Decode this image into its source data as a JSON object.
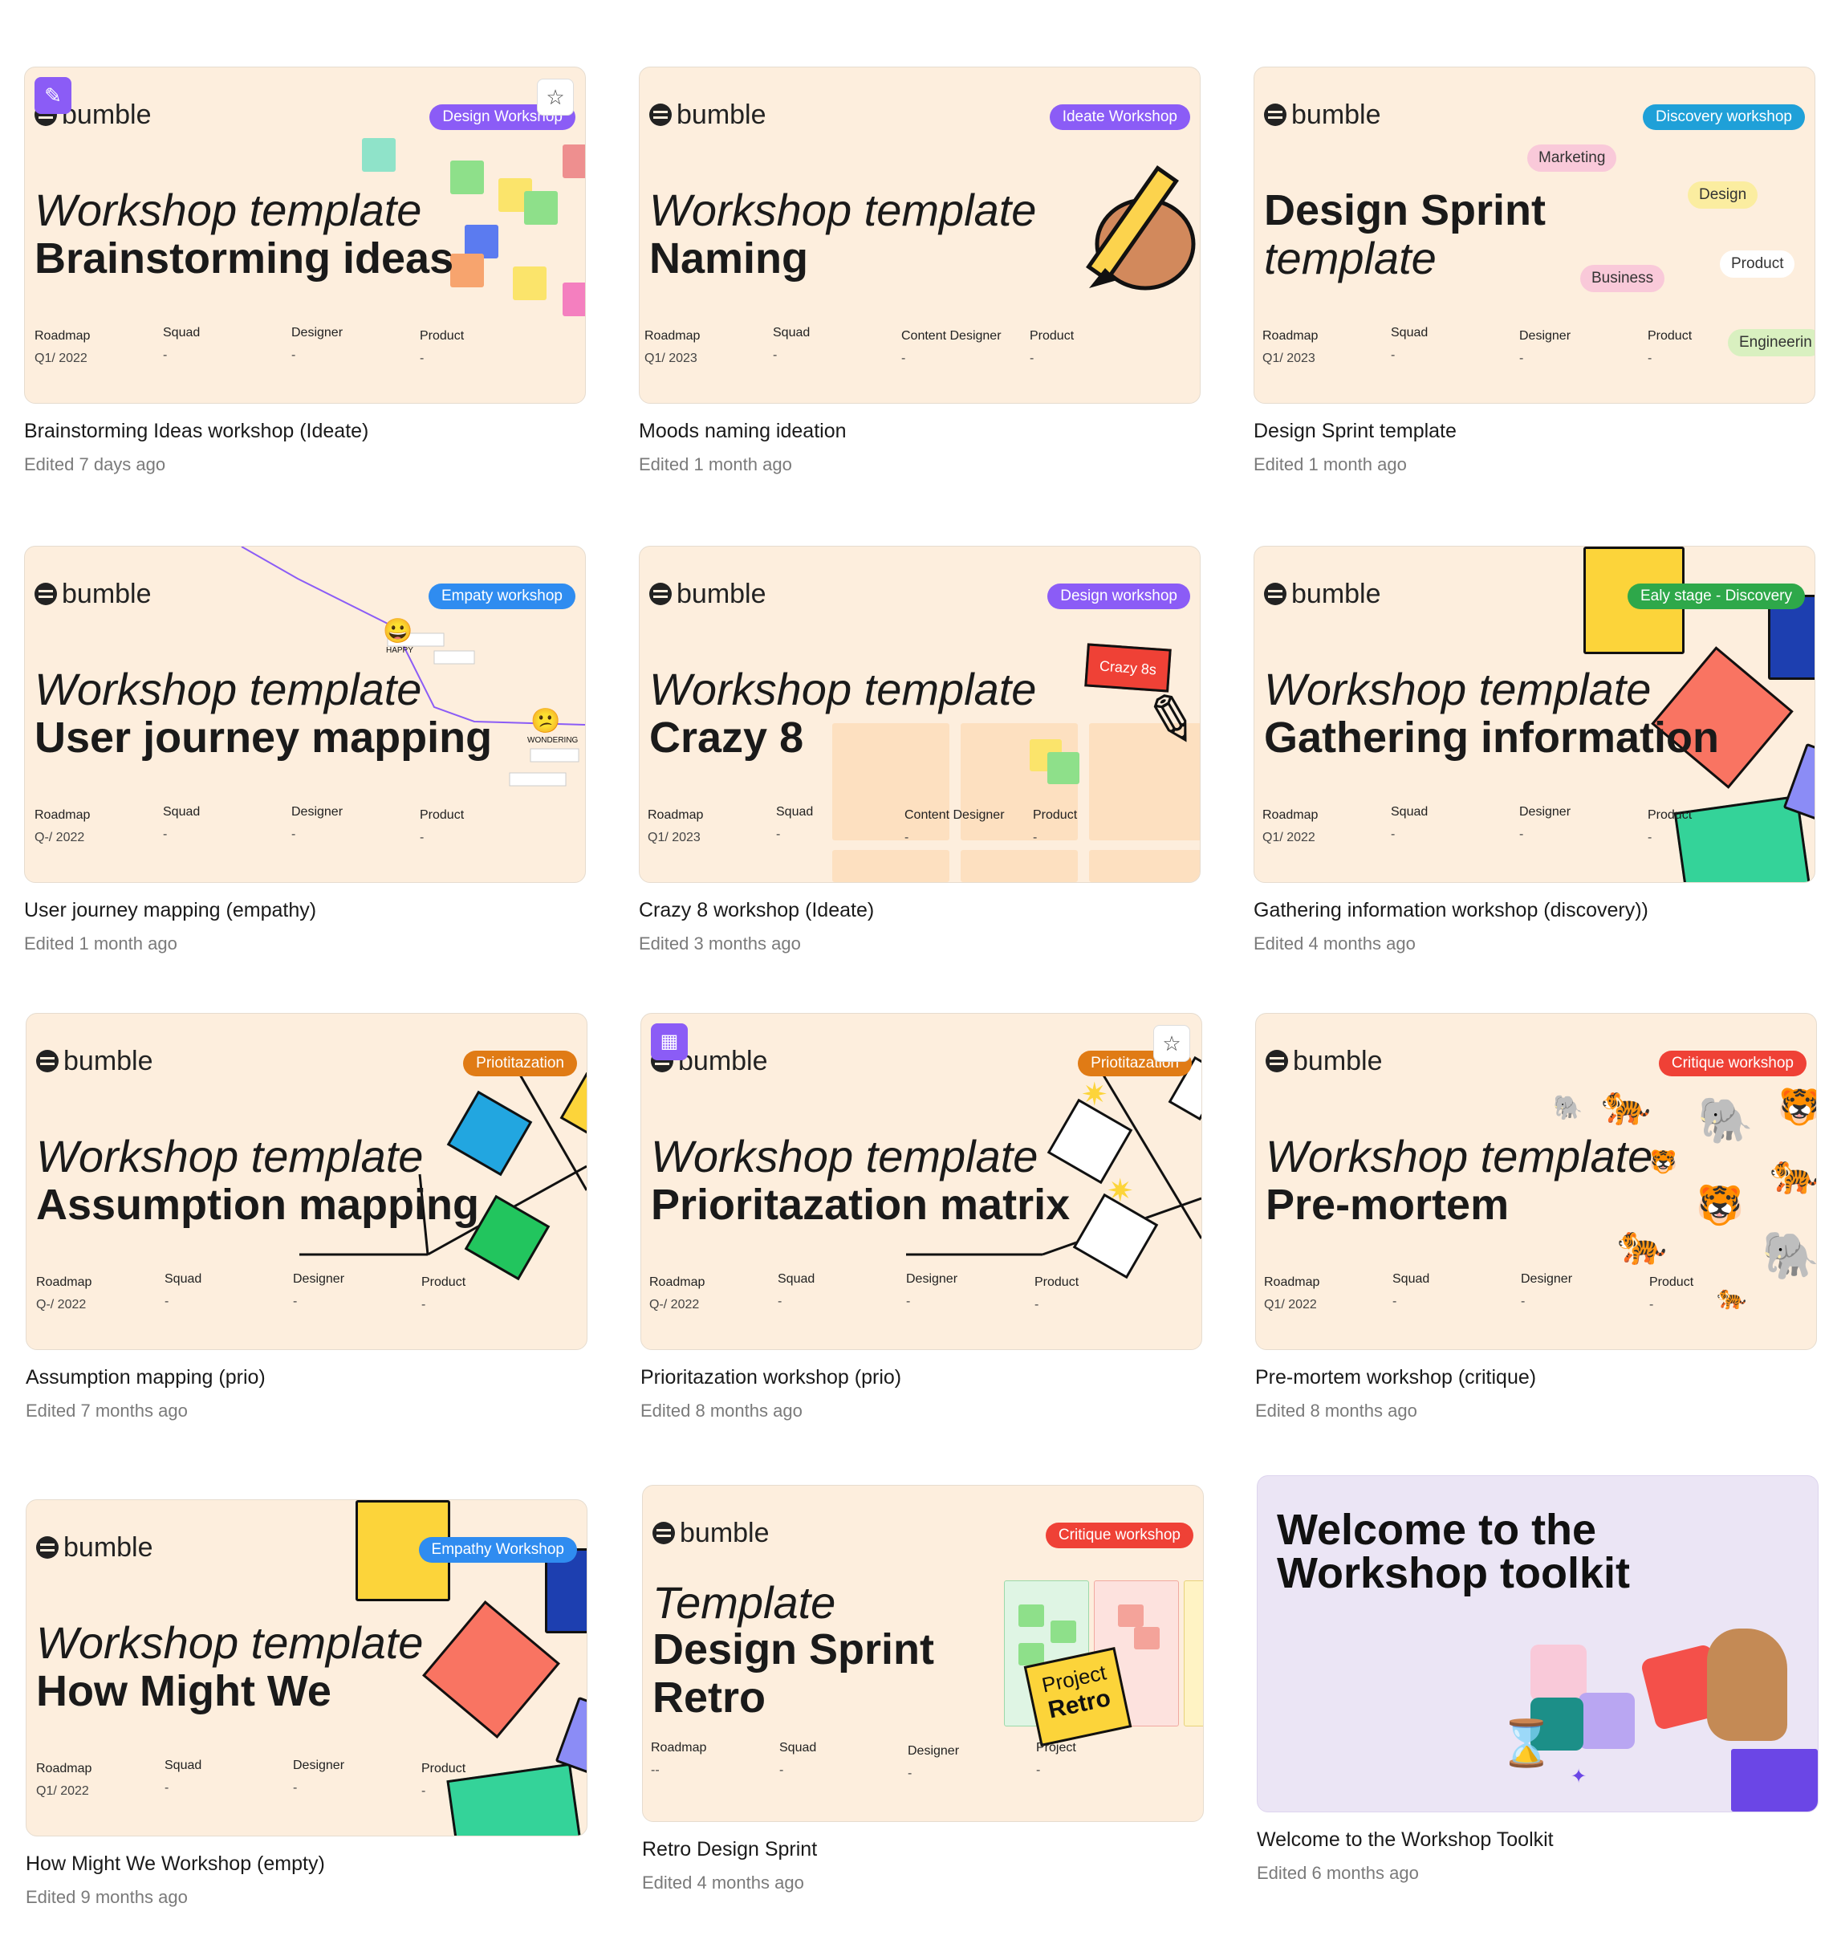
{
  "cards": [
    {
      "title": "Brainstorming Ideas workshop (Ideate)",
      "edited": "Edited 7 days ago",
      "logo": "bumble",
      "badge": "Design Workshop",
      "badge_color": "#8b5cf6",
      "line1": "Workshop template",
      "line2": "Brainstorming ideas",
      "meta": [
        {
          "label": "Roadmap",
          "value": "Q1/ 2022"
        },
        {
          "label": "Squad",
          "value": "-"
        },
        {
          "label": "Designer",
          "value": "-"
        },
        {
          "label": "Product",
          "value": "-"
        }
      ]
    },
    {
      "title": "Moods naming ideation",
      "edited": "Edited 1 month ago",
      "logo": "bumble",
      "badge": "Ideate Workshop",
      "badge_color": "#8b5cf6",
      "line1": "Workshop template",
      "line2": "Naming",
      "meta": [
        {
          "label": "Roadmap",
          "value": "Q1/ 2023"
        },
        {
          "label": "Squad",
          "value": "-"
        },
        {
          "label": "Content Designer",
          "value": "-"
        },
        {
          "label": "Product",
          "value": "-"
        }
      ]
    },
    {
      "title": "Design Sprint template",
      "edited": "Edited 1 month ago",
      "logo": "bumble",
      "badge": "Discovery workshop",
      "badge_color": "#1fa0d8",
      "line1": "Design Sprint",
      "line2": "template",
      "tags": [
        "Marketing",
        "Design",
        "Product",
        "Business",
        "Engineerin"
      ],
      "meta": [
        {
          "label": "Roadmap",
          "value": "Q1/ 2023"
        },
        {
          "label": "Squad",
          "value": "-"
        },
        {
          "label": "Designer",
          "value": "-"
        },
        {
          "label": "Product",
          "value": "-"
        }
      ]
    },
    {
      "title": "User journey mapping (empathy)",
      "edited": "Edited 1 month ago",
      "logo": "bumble",
      "badge": "Empaty workshop",
      "badge_color": "#2f8cf0",
      "line1": "Workshop template",
      "line2": "User journey mapping",
      "journey": [
        "HAPPY",
        "WONDERING"
      ],
      "meta": [
        {
          "label": "Roadmap",
          "value": "Q-/ 2022"
        },
        {
          "label": "Squad",
          "value": "-"
        },
        {
          "label": "Designer",
          "value": "-"
        },
        {
          "label": "Product",
          "value": "-"
        }
      ]
    },
    {
      "title": "Crazy 8 workshop (Ideate)",
      "edited": "Edited 3 months ago",
      "logo": "bumble",
      "badge": "Design workshop",
      "badge_color": "#8b5cf6",
      "line1": "Workshop template",
      "line2": "Crazy 8",
      "sticker": "Crazy 8s",
      "meta": [
        {
          "label": "Roadmap",
          "value": "Q1/ 2023"
        },
        {
          "label": "Squad",
          "value": "-"
        },
        {
          "label": "Content Designer",
          "value": "-"
        },
        {
          "label": "Product",
          "value": "-"
        }
      ]
    },
    {
      "title": "Gathering information workshop (discovery))",
      "edited": "Edited 4 months ago",
      "logo": "bumble",
      "badge": "Ealy stage - Discovery",
      "badge_color": "#2ea84a",
      "line1": "Workshop template",
      "line2": "Gathering information",
      "meta": [
        {
          "label": "Roadmap",
          "value": "Q1/ 2022"
        },
        {
          "label": "Squad",
          "value": "-"
        },
        {
          "label": "Designer",
          "value": "-"
        },
        {
          "label": "Product",
          "value": "-"
        }
      ]
    },
    {
      "title": "Assumption mapping (prio)",
      "edited": "Edited 7 months ago",
      "logo": "bumble",
      "badge": "Priotitazation",
      "badge_color": "#e07b15",
      "line1": "Workshop template",
      "line2": "Assumption mapping",
      "meta": [
        {
          "label": "Roadmap",
          "value": "Q-/ 2022"
        },
        {
          "label": "Squad",
          "value": "-"
        },
        {
          "label": "Designer",
          "value": "-"
        },
        {
          "label": "Product",
          "value": "-"
        }
      ]
    },
    {
      "title": "Prioritazation workshop (prio)",
      "edited": "Edited 8 months ago",
      "logo": "bumble",
      "badge": "Priotitazation",
      "badge_color": "#e07b15",
      "line1": "Workshop template",
      "line2": "Prioritazation matrix",
      "meta": [
        {
          "label": "Roadmap",
          "value": "Q-/ 2022"
        },
        {
          "label": "Squad",
          "value": "-"
        },
        {
          "label": "Designer",
          "value": "-"
        },
        {
          "label": "Product",
          "value": "-"
        }
      ]
    },
    {
      "title": "Pre-mortem workshop (critique)",
      "edited": "Edited 8 months ago",
      "logo": "bumble",
      "badge": "Critique workshop",
      "badge_color": "#ef4136",
      "line1": "Workshop template",
      "line2": "Pre-mortem",
      "meta": [
        {
          "label": "Roadmap",
          "value": "Q1/ 2022"
        },
        {
          "label": "Squad",
          "value": "-"
        },
        {
          "label": "Designer",
          "value": "-"
        },
        {
          "label": "Product",
          "value": "-"
        }
      ]
    },
    {
      "title": "How Might We Workshop (empty)",
      "edited": "Edited 9 months ago",
      "logo": "bumble",
      "badge": "Empathy Workshop",
      "badge_color": "#2f8cf0",
      "line1": "Workshop template",
      "line2": "How Might We",
      "meta": [
        {
          "label": "Roadmap",
          "value": "Q1/ 2022"
        },
        {
          "label": "Squad",
          "value": "-"
        },
        {
          "label": "Designer",
          "value": "-"
        },
        {
          "label": "Product",
          "value": "-"
        }
      ]
    },
    {
      "title": "Retro Design Sprint",
      "edited": "Edited 4 months ago",
      "logo": "bumble",
      "badge": "Critique workshop",
      "badge_color": "#ef4136",
      "line1": "Template",
      "line2": "Design Sprint",
      "line3": "Retro",
      "sticker1": "Project",
      "sticker2": "Retro",
      "meta": [
        {
          "label": "Roadmap",
          "value": "--"
        },
        {
          "label": "Squad",
          "value": "-"
        },
        {
          "label": "Designer",
          "value": "-"
        },
        {
          "label": "Project",
          "value": "-"
        }
      ]
    },
    {
      "title": "Welcome to the Workshop Toolkit",
      "edited": "Edited 6 months ago",
      "heading1": "Welcome to the",
      "heading2": "Workshop toolkit"
    }
  ],
  "colors": {
    "peach": "#fdeedd",
    "lavender": "#ebe5f5",
    "purple": "#8b5cf6"
  }
}
